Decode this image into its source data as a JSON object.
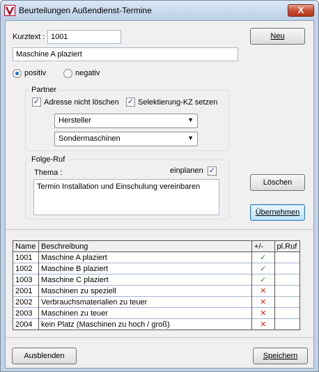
{
  "window": {
    "title": "Beurteilungen Außendienst-Termine",
    "close_glyph": "X"
  },
  "form": {
    "kurztext_label": "Kurztext :",
    "kurztext_value": "1001",
    "description_value": "Maschine A plaziert",
    "radio_positiv": "positiv",
    "radio_negativ": "negativ",
    "selected_radio": "positiv"
  },
  "partner": {
    "title": "Partner",
    "check_adresse": "Adresse nicht löschen",
    "check_selektierung": "Selektierung-KZ setzen",
    "select1": "Hersteller",
    "select2": "Sondermaschinen"
  },
  "folgeruf": {
    "title": "Folge-Ruf",
    "thema_label": "Thema :",
    "einplanen_label": "einplanen",
    "thema_text": "Termin Installation und Einschulung vereinbaren"
  },
  "buttons": {
    "neu": "Neu",
    "loeschen": "Löschen",
    "uebernehmen": "Übernehmen",
    "ausblenden": "Ausblenden",
    "speichern": "Speichern"
  },
  "table": {
    "headers": [
      "Name",
      "Beschreibung",
      "+/-",
      "pl.Ruf"
    ],
    "rows": [
      {
        "name": "1001",
        "desc": "Maschine A plaziert",
        "status": "positive"
      },
      {
        "name": "1002",
        "desc": "Maschine  B plaziert",
        "status": "positive"
      },
      {
        "name": "1003",
        "desc": "Maschine C plaziert",
        "status": "positive"
      },
      {
        "name": "2001",
        "desc": "Maschinen zu speziell",
        "status": "negative"
      },
      {
        "name": "2002",
        "desc": "Verbrauchsmaterialien zu teuer",
        "status": "negative"
      },
      {
        "name": "2003",
        "desc": "Maschinen zu teuer",
        "status": "negative"
      },
      {
        "name": "2004",
        "desc": "kein Platz (Maschinen zu hoch / groß)",
        "status": "negative"
      }
    ],
    "check_glyph": "✓",
    "cross_glyph": "✕"
  }
}
